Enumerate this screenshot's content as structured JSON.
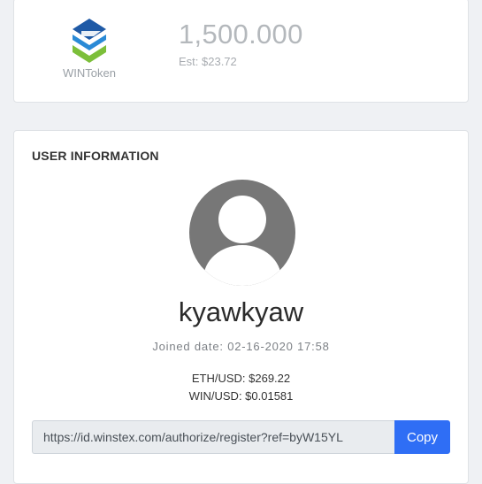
{
  "token": {
    "name": "WINToken",
    "balance": "1,500.000",
    "estimate": "Est: $23.72"
  },
  "user_info": {
    "title": "USER INFORMATION",
    "username": "kyawkyaw",
    "joined": "Joined date: 02-16-2020 17:58",
    "eth_usd": "ETH/USD: $269.22",
    "win_usd": "WIN/USD: $0.01581",
    "referral_url": "https://id.winstex.com/authorize/register?ref=byW15YL",
    "copy_label": "Copy"
  },
  "colors": {
    "logo_blue": "#1f5aa6",
    "logo_green": "#7cbf3a",
    "accent": "#2f6ef5",
    "avatar": "#777777"
  }
}
